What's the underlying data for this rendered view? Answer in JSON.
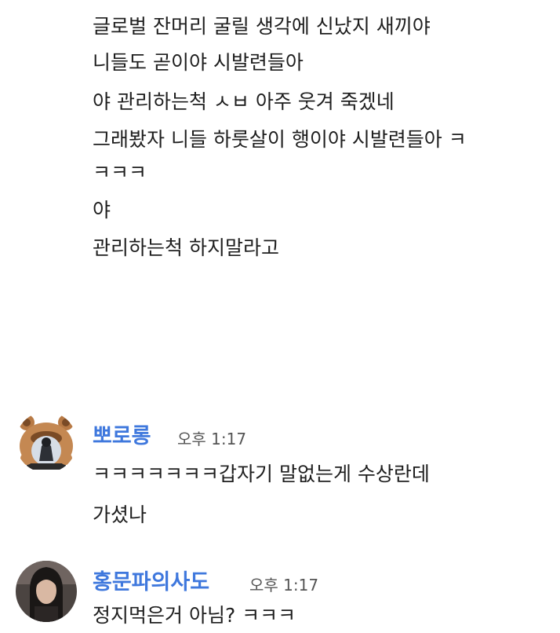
{
  "previous_messages": [
    "글로벌 잔머리 굴릴 생각에 신났지 새끼야",
    "니들도 곧이야 시발련들아",
    "야 관리하는척 ㅅㅂ 아주 웃겨 죽겠네",
    "그래봤자 니들 하룻살이 행이야 시발련들아 ㅋ",
    "ㅋㅋㅋ",
    "야",
    "관리하는척 하지말라고"
  ],
  "messages": [
    {
      "sender": "뽀로롱",
      "time": "오후 1:17",
      "lines": [
        "ㅋㅋㅋㅋㅋㅋㅋ갑자기 말없는게 수상란데",
        "가셨나"
      ]
    },
    {
      "sender": "홍문파의사도",
      "time": "오후 1:17",
      "lines": [
        "정지먹은거 아님? ㅋㅋㅋ"
      ]
    }
  ],
  "colors": {
    "sender_name": "#3f78dd",
    "message_text": "#1e1e1e",
    "timestamp": "#555555",
    "background": "#ffffff"
  }
}
